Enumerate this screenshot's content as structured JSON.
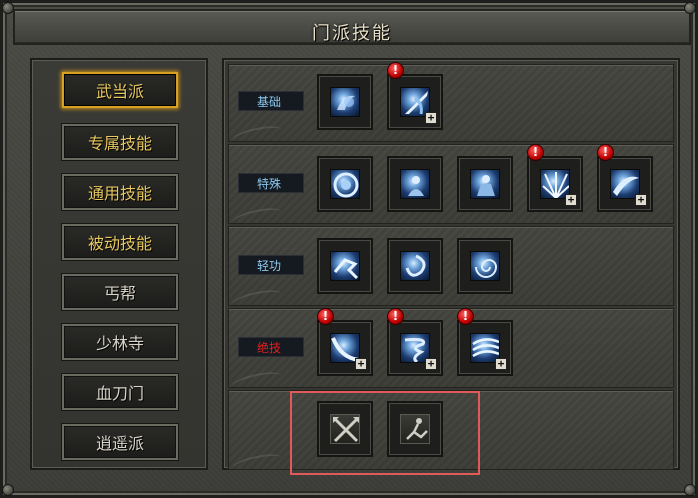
{
  "window": {
    "title": "门派技能"
  },
  "categories": [
    {
      "label": "武当派",
      "style": "gold",
      "active": true
    },
    {
      "label": "专属技能",
      "style": "gold",
      "active": false
    },
    {
      "label": "通用技能",
      "style": "gold",
      "active": false
    },
    {
      "label": "被动技能",
      "style": "gold",
      "active": false
    },
    {
      "label": "丐帮",
      "style": "normal",
      "active": false
    },
    {
      "label": "少林寺",
      "style": "normal",
      "active": false
    },
    {
      "label": "血刀门",
      "style": "normal",
      "active": false
    },
    {
      "label": "逍遥派",
      "style": "normal",
      "active": false
    }
  ],
  "skill_rows": [
    {
      "label": "基础",
      "label_color": "#8cc8f0",
      "skills": [
        {
          "icon": "wind-palm-icon",
          "alert": false,
          "plus": false
        },
        {
          "icon": "sword-strike-icon",
          "alert": true,
          "plus": true
        }
      ]
    },
    {
      "label": "特殊",
      "label_color": "#8cc8f0",
      "skills": [
        {
          "icon": "shield-ring-icon",
          "alert": false,
          "plus": false
        },
        {
          "icon": "meditation-icon",
          "alert": false,
          "plus": false
        },
        {
          "icon": "aura-body-icon",
          "alert": false,
          "plus": false
        },
        {
          "icon": "light-burst-icon",
          "alert": true,
          "plus": true
        },
        {
          "icon": "blade-wave-icon",
          "alert": true,
          "plus": true
        }
      ]
    },
    {
      "label": "轻功",
      "label_color": "#8cc8f0",
      "skills": [
        {
          "icon": "dash-runner-icon",
          "alert": false,
          "plus": false
        },
        {
          "icon": "whirl-step-icon",
          "alert": false,
          "plus": false
        },
        {
          "icon": "vortex-icon",
          "alert": false,
          "plus": false
        }
      ]
    },
    {
      "label": "绝技",
      "label_color": "#e02020",
      "skills": [
        {
          "icon": "slash-arc-icon",
          "alert": true,
          "plus": true
        },
        {
          "icon": "tornado-icon",
          "alert": true,
          "plus": true
        },
        {
          "icon": "tidal-wave-icon",
          "alert": true,
          "plus": true
        }
      ]
    },
    {
      "label": "",
      "label_color": "#8cc8f0",
      "skills": [
        {
          "icon": "crossed-swords-icon",
          "alert": false,
          "plus": false
        },
        {
          "icon": "kick-stance-icon",
          "alert": false,
          "plus": false
        }
      ]
    }
  ],
  "alert_symbol": "!",
  "plus_symbol": "+"
}
